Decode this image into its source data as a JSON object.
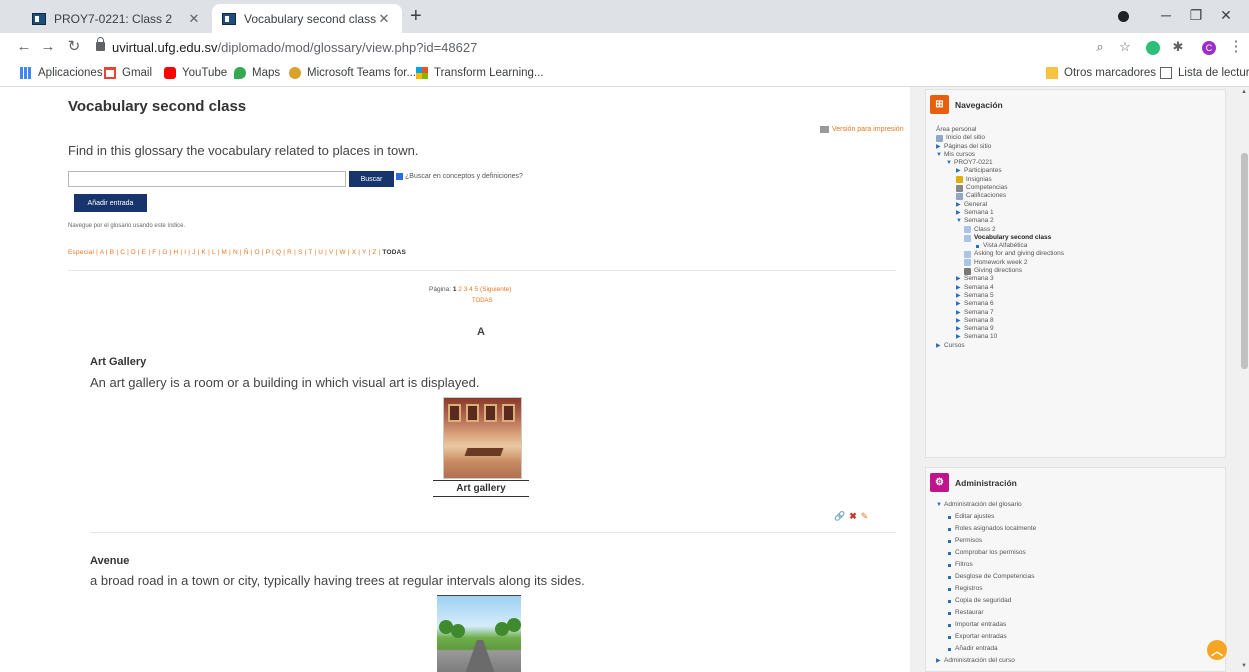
{
  "browser": {
    "tabs": [
      {
        "title": "PROY7-0221: Class 2",
        "active": false
      },
      {
        "title": "Vocabulary second class",
        "active": true
      }
    ],
    "url_host": "uvirtual.ufg.edu.sv",
    "url_path": "/diplomado/mod/glossary/view.php?id=48627",
    "bookmarks": [
      "Aplicaciones",
      "Gmail",
      "YouTube",
      "Maps",
      "Microsoft Teams for...",
      "Transform Learning..."
    ],
    "bookmarks_right": [
      "Otros marcadores",
      "Lista de lectura"
    ],
    "profile_initial": "C"
  },
  "glossary": {
    "title": "Vocabulary second class",
    "print_link": "Versión para impresión",
    "intro": "Find in this glossary the vocabulary related to places in town.",
    "search_button": "Buscar",
    "search_option": "¿Buscar en conceptos y definiciones?",
    "add_entry": "Añadir entrada",
    "browse_note": "Navegue por el glosario usando este índice.",
    "alphabet": "Especial | A | B | C | D | E | F | G | H | I | J | K | L | M | N | Ñ | O | P | Q | R | S | T | U | V | W | X | Y | Z |",
    "alphabet_all": "TODAS",
    "paging_label": "Página:",
    "paging_current": "1",
    "paging_links": "2 3 4 5 (Siguiente)",
    "paging_all": "TODAS",
    "letter_heading": "A",
    "entries": [
      {
        "concept": "Art Gallery",
        "definition": "An art gallery is a room or a building in which visual art is displayed.",
        "image_caption": "Art gallery"
      },
      {
        "concept": "Avenue",
        "definition": "a broad road in a town or city, typically having trees at regular intervals along its sides."
      }
    ]
  },
  "navigation": {
    "title": "Navegación",
    "items": [
      {
        "label": "Área personal"
      },
      {
        "label": "Inicio del sitio"
      },
      {
        "label": "Páginas del sitio"
      },
      {
        "label": "Mis cursos"
      },
      {
        "label": "PROY7-0221"
      },
      {
        "label": "Participantes"
      },
      {
        "label": "Insignias"
      },
      {
        "label": "Competencias"
      },
      {
        "label": "Calificaciones"
      },
      {
        "label": "General"
      },
      {
        "label": "Semana 1"
      },
      {
        "label": "Semana 2"
      },
      {
        "label": "Class 2"
      },
      {
        "label": "Vocabulary second class"
      },
      {
        "label": "Vista Alfabética"
      },
      {
        "label": "Asking for and giving directions"
      },
      {
        "label": "Homework week 2"
      },
      {
        "label": "Giving directions"
      },
      {
        "label": "Semana 3"
      },
      {
        "label": "Semana 4"
      },
      {
        "label": "Semana 5"
      },
      {
        "label": "Semana 6"
      },
      {
        "label": "Semana 7"
      },
      {
        "label": "Semana 8"
      },
      {
        "label": "Semana 9"
      },
      {
        "label": "Semana 10"
      },
      {
        "label": "Cursos"
      }
    ]
  },
  "administration": {
    "title": "Administración",
    "section": "Administración del glosario",
    "items": [
      {
        "label": "Editar ajustes"
      },
      {
        "label": "Roles asignados localmente"
      },
      {
        "label": "Permisos"
      },
      {
        "label": "Comprobar los permisos"
      },
      {
        "label": "Filtros"
      },
      {
        "label": "Desglose de Competencias"
      },
      {
        "label": "Registros"
      },
      {
        "label": "Copia de seguridad"
      },
      {
        "label": "Restaurar"
      },
      {
        "label": "Importar entradas"
      },
      {
        "label": "Exportar entradas"
      },
      {
        "label": "Añadir entrada"
      }
    ],
    "course_admin": "Administración del curso"
  },
  "colors": {
    "accent": "#e87722",
    "primary_button": "#17346c",
    "nav_icon": "#e8600e",
    "admin_icon": "#c0148c"
  }
}
